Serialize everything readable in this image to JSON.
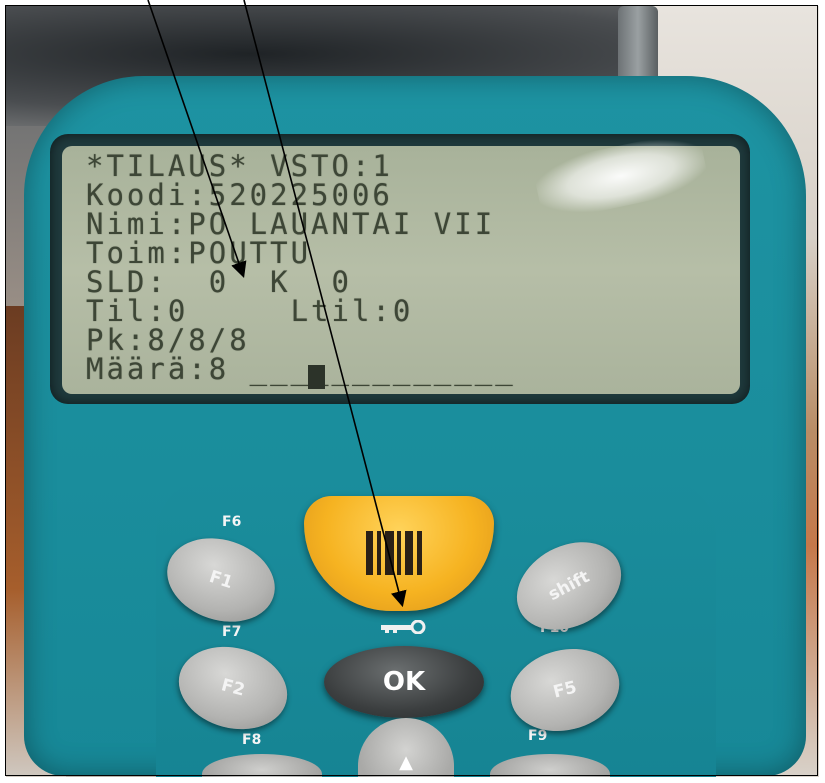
{
  "screen": {
    "lines": [
      "*TILAUS* VSTO:1",
      "Koodi:520225006",
      "Nimi:PO LAUANTAI VII",
      "Toim:POUTTU",
      "SLD:  0  K  0",
      "Til:0     Ltil:0",
      "Pk:8/8/8",
      "Määrä:8 _____________"
    ]
  },
  "keys": {
    "f1": "F1",
    "f2": "F2",
    "f5": "F5",
    "f6": "F6",
    "f7": "F7",
    "f8": "F8",
    "f9": "F9",
    "f10": "F10",
    "shift": "shift",
    "ok": "OK",
    "up": "▲"
  },
  "colors": {
    "device_body": "#1d93a2",
    "lcd_background": "#b6bea7",
    "lcd_text": "#3d4636",
    "scan_button": "#f6b321",
    "ok_button": "#3b3e3f",
    "grey_button": "#b3b3b1"
  },
  "icons": {
    "scan_button": "barcode-icon",
    "lock_key": "key-icon",
    "up_button": "up-arrow-icon"
  }
}
